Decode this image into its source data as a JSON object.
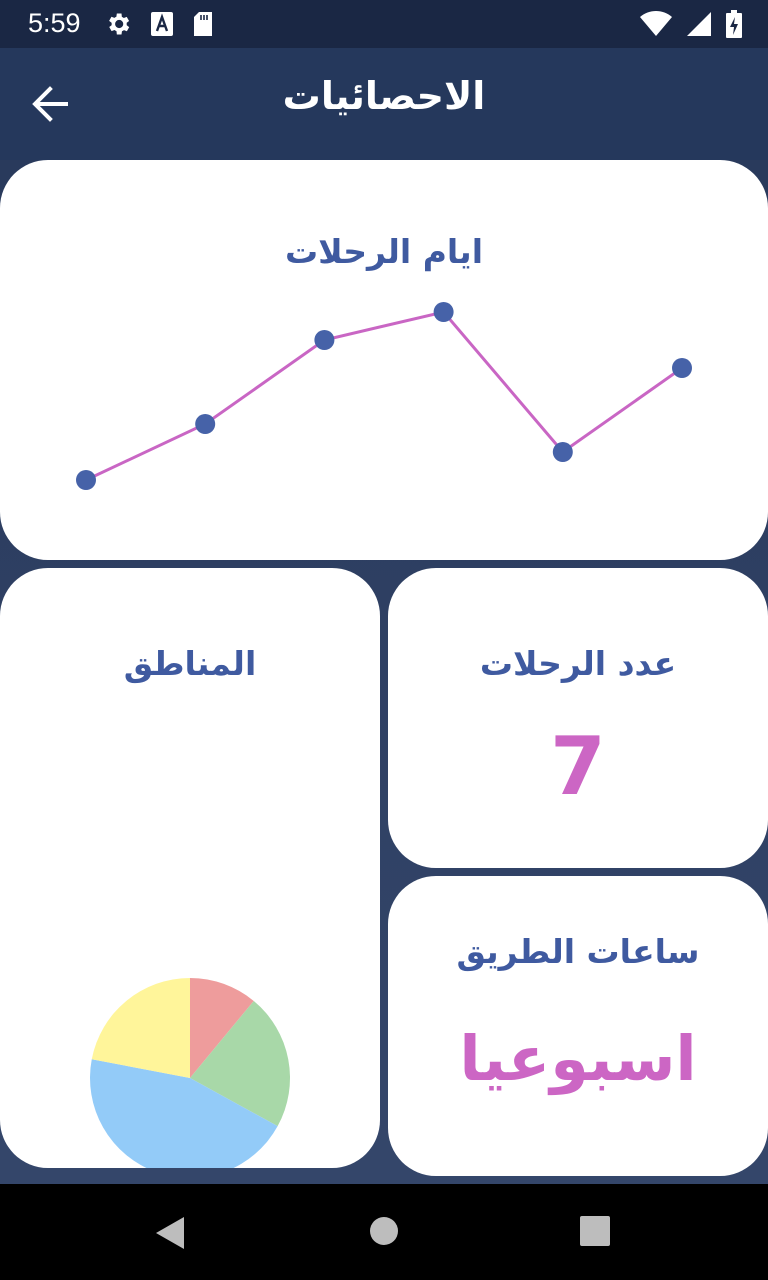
{
  "status": {
    "time": "5:59",
    "icons_left": [
      "settings-icon",
      "text-a-icon",
      "sd-card-icon"
    ],
    "icons_right": [
      "wifi-icon",
      "signal-icon",
      "battery-charging-icon"
    ]
  },
  "app_bar": {
    "title": "الاحصائيات",
    "back_icon": "arrow-back-icon"
  },
  "trip_days_card": {
    "title": "ايام الرحلات"
  },
  "regions_card": {
    "title": "المناطق"
  },
  "trips_count_card": {
    "title": "عدد الرحلات",
    "value": "7"
  },
  "road_hours_card": {
    "title": "ساعات الطريق",
    "value": "اسبوعيا"
  },
  "chart_data": [
    {
      "type": "line",
      "x": [
        1,
        2,
        3,
        4,
        5,
        6
      ],
      "series": [
        {
          "values": [
            1,
            3,
            6,
            7,
            2,
            5
          ],
          "color": "#c966c4",
          "point_color": "#4662a8"
        }
      ],
      "ylim": [
        0,
        7
      ],
      "grid": false,
      "axes_visible": false
    },
    {
      "type": "pie",
      "slices": [
        {
          "value": 11,
          "color": "#ee9c9c"
        },
        {
          "value": 22,
          "color": "#a8d8a8"
        },
        {
          "value": 45,
          "color": "#93cbf8"
        },
        {
          "value": 22,
          "color": "#fff59a"
        }
      ],
      "start_angle_deg": 0,
      "direction": "clockwise"
    }
  ],
  "nav": {
    "back": "triangle-back-icon",
    "home": "circle-home-icon",
    "recents": "square-recents-icon"
  }
}
